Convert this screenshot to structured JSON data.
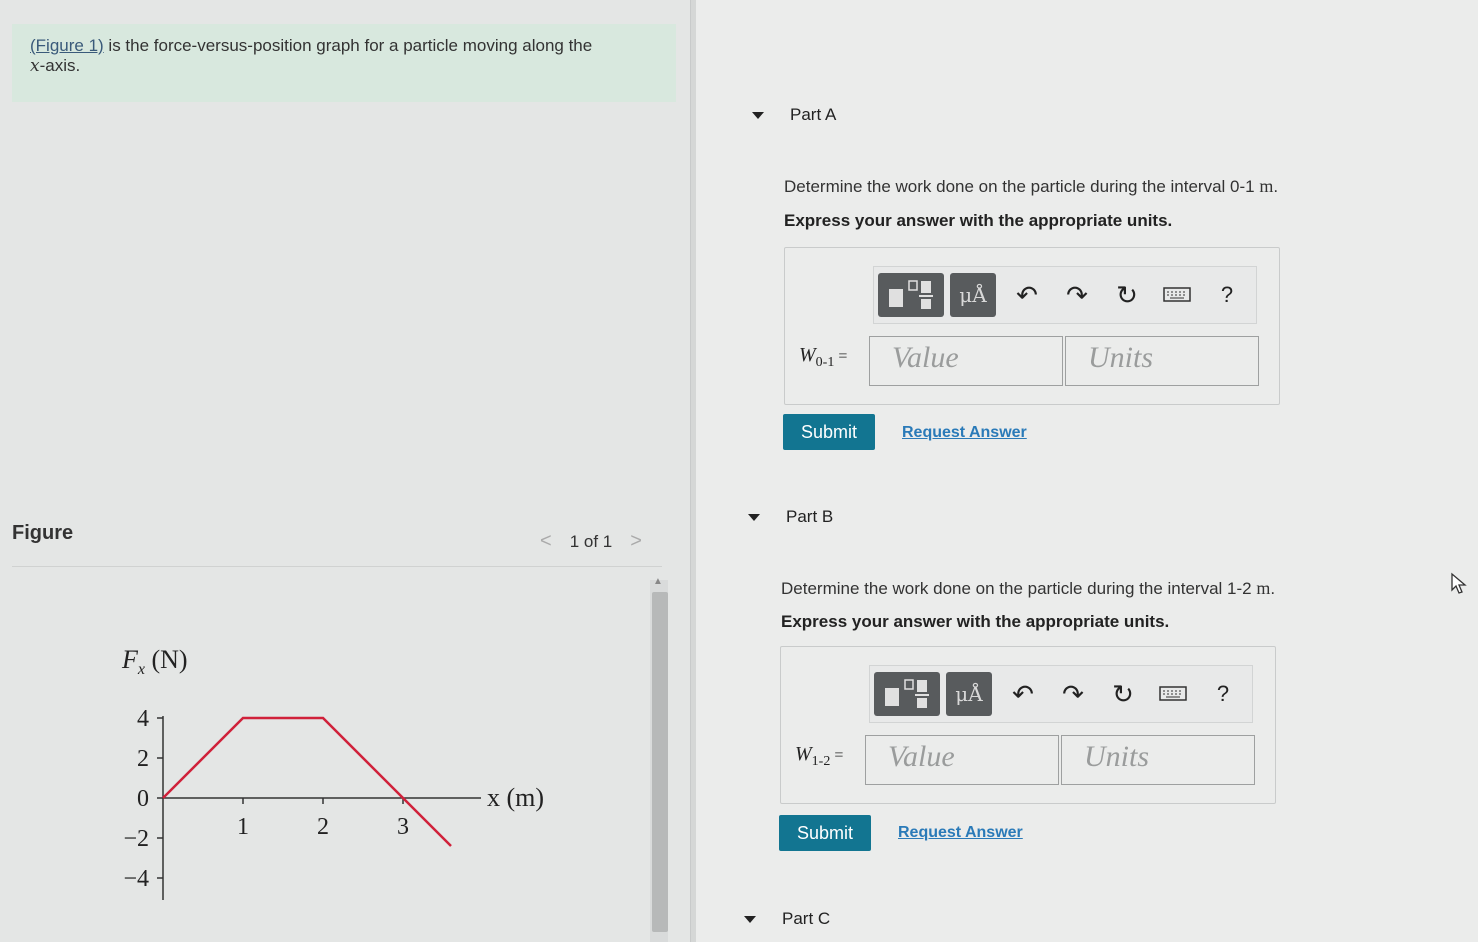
{
  "intro": {
    "figure_link": "(Figure 1)",
    "text_before_axis": " is the force-versus-position graph for a particle moving along the ",
    "axis_symbol": "x",
    "text_after_axis": "-axis."
  },
  "figure": {
    "title": "Figure",
    "pager": {
      "prev": "<",
      "count": "1 of 1",
      "next": ">"
    }
  },
  "chart_data": {
    "type": "line",
    "title": "",
    "ylabel": "F_x (N)",
    "xlabel": "x (m)",
    "ylabel_main": "F",
    "ylabel_sub": "x",
    "ylabel_unit": "(N)",
    "xlabel_text": "x (m)",
    "x_ticks": [
      1,
      2,
      3
    ],
    "x_tick_labels": [
      "1",
      "2",
      "3"
    ],
    "y_ticks": [
      4,
      2,
      0,
      -2,
      -4
    ],
    "y_tick_labels": [
      "4",
      "2",
      "0",
      "−2",
      "−4"
    ],
    "xlim": [
      0,
      4
    ],
    "ylim": [
      -4,
      4
    ],
    "series": [
      {
        "x": [
          0,
          1,
          2,
          3,
          3.6
        ],
        "y": [
          0,
          4,
          4,
          0,
          -2.4
        ],
        "color": "#d0213a"
      }
    ],
    "grid": false
  },
  "parts": [
    {
      "label": "Part A",
      "question_prefix": "Determine the work done on the particle during the interval 0-1 ",
      "question_unit": "m",
      "question_suffix": ".",
      "instruction": "Express your answer with the appropriate units.",
      "var_main": "W",
      "var_sub": "0-1",
      "equals": "=",
      "value_placeholder": "Value",
      "units_placeholder": "Units",
      "submit": "Submit",
      "request": "Request Answer"
    },
    {
      "label": "Part B",
      "question_prefix": "Determine the work done on the particle during the interval 1-2 ",
      "question_unit": "m",
      "question_suffix": ".",
      "instruction": "Express your answer with the appropriate units.",
      "var_main": "W",
      "var_sub": "1-2",
      "equals": "=",
      "value_placeholder": "Value",
      "units_placeholder": "Units",
      "submit": "Submit",
      "request": "Request Answer"
    },
    {
      "label": "Part C"
    }
  ],
  "toolbar": {
    "units_button": "μÅ",
    "undo_icon": "undo-icon",
    "redo_icon": "redo-icon",
    "reset_icon": "reset-icon",
    "keyboard_icon": "keyboard-icon",
    "help_label": "?"
  }
}
